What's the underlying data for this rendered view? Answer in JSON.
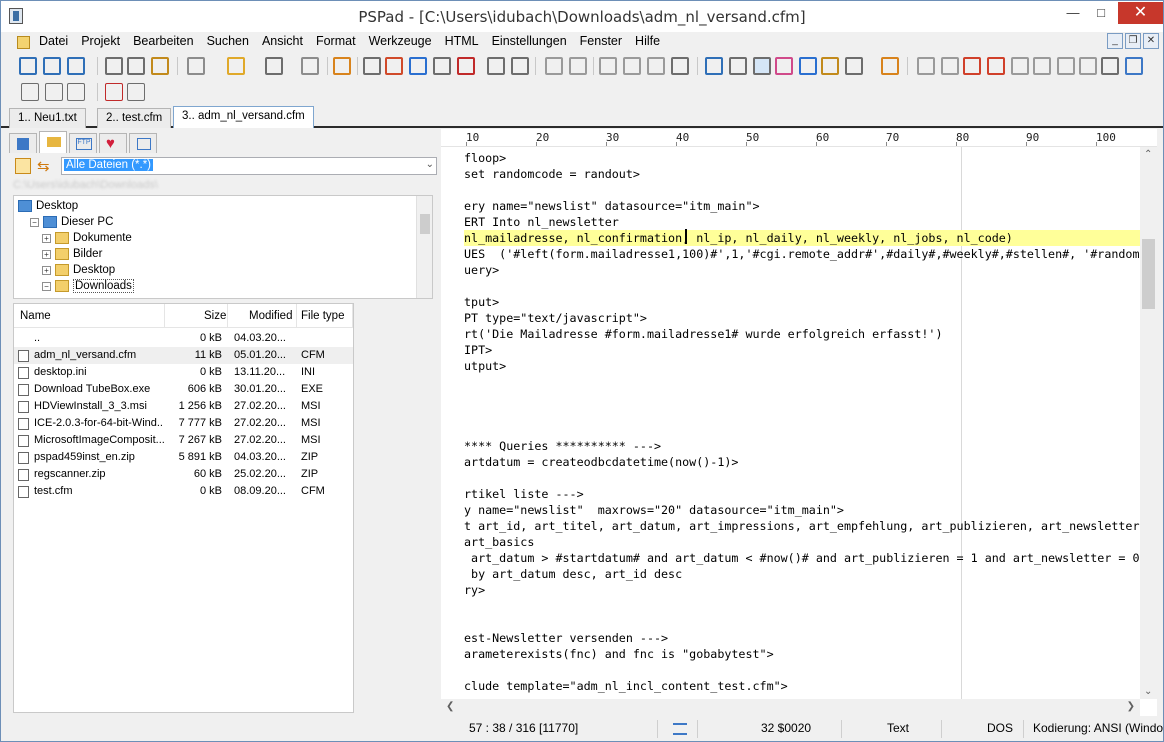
{
  "window": {
    "title": "PSPad - [C:\\Users\\idubach\\Downloads\\adm_nl_versand.cfm]"
  },
  "menu": [
    "Datei",
    "Projekt",
    "Bearbeiten",
    "Suchen",
    "Ansicht",
    "Format",
    "Werkzeuge",
    "HTML",
    "Einstellungen",
    "Fenster",
    "Hilfe"
  ],
  "tabs": [
    "1.. Neu1.txt",
    "2.. test.cfm",
    "3.. adm_nl_versand.cfm"
  ],
  "filter": {
    "value": "Alle Dateien (*.*)"
  },
  "tree": [
    {
      "label": "Desktop",
      "indent": 0,
      "icon": "desktop-icon"
    },
    {
      "label": "Dieser PC",
      "indent": 1,
      "icon": "pc-icon"
    },
    {
      "label": "Dokumente",
      "indent": 2,
      "icon": "folder-icon"
    },
    {
      "label": "Bilder",
      "indent": 2,
      "icon": "folder-icon"
    },
    {
      "label": "Desktop",
      "indent": 2,
      "icon": "folder-icon"
    },
    {
      "label": "Downloads",
      "indent": 2,
      "icon": "folder-icon"
    }
  ],
  "filelist": {
    "headers": {
      "name": "Name",
      "size": "Size",
      "modified": "Modified",
      "type": "File type"
    },
    "rows": [
      {
        "name": "..",
        "size": "0 kB",
        "modified": "04.03.20...",
        "type": ""
      },
      {
        "name": "adm_nl_versand.cfm",
        "size": "11 kB",
        "modified": "05.01.20...",
        "type": "CFM"
      },
      {
        "name": "desktop.ini",
        "size": "0 kB",
        "modified": "13.11.20...",
        "type": "INI"
      },
      {
        "name": "Download TubeBox.exe",
        "size": "606 kB",
        "modified": "30.01.20...",
        "type": "EXE"
      },
      {
        "name": "HDViewInstall_3_3.msi",
        "size": "1 256 kB",
        "modified": "27.02.20...",
        "type": "MSI"
      },
      {
        "name": "ICE-2.0.3-for-64-bit-Wind...",
        "size": "7 777 kB",
        "modified": "27.02.20...",
        "type": "MSI"
      },
      {
        "name": "MicrosoftImageComposit...",
        "size": "7 267 kB",
        "modified": "27.02.20...",
        "type": "MSI"
      },
      {
        "name": "pspad459inst_en.zip",
        "size": "5 891 kB",
        "modified": "04.03.20...",
        "type": "ZIP"
      },
      {
        "name": "regscanner.zip",
        "size": "60 kB",
        "modified": "25.02.20...",
        "type": "ZIP"
      },
      {
        "name": "test.cfm",
        "size": "0 kB",
        "modified": "08.09.20...",
        "type": "CFM"
      }
    ]
  },
  "ruler": [
    "10",
    "20",
    "30",
    "40",
    "50",
    "60",
    "70",
    "80",
    "90",
    "100"
  ],
  "code_lines": [
    "floop>",
    "set randomcode = randout>",
    "",
    "ery name=\"newslist\" datasource=\"itm_main\">",
    "ERT Into nl_newsletter",
    "nl_mailadresse, nl_confirmation, nl_ip, nl_daily, nl_weekly, nl_jobs, nl_code)",
    "UES  ('#left(form.mailadresse1,100)#',1,'#cgi.remote_addr#',#daily#,#weekly#,#stellen#, '#randomcode#')",
    "uery>",
    "",
    "tput>",
    "PT type=\"text/javascript\">",
    "rt('Die Mailadresse #form.mailadresse1# wurde erfolgreich erfasst!')",
    "IPT>",
    "utput>",
    "",
    "",
    "",
    "",
    "**** Queries ********** --->",
    "artdatum = createodbcdatetime(now()-1)>",
    "",
    "rtikel liste --->",
    "y name=\"newslist\"  maxrows=\"20\" datasource=\"itm_main\">",
    "t art_id, art_titel, art_datum, art_impressions, art_empfehlung, art_publizieren, art_newsletter",
    "art_basics",
    " art_datum > #startdatum# and art_datum < #now()# and art_publizieren = 1 and art_newsletter = 0",
    " by art_datum desc, art_id desc",
    "ry>",
    "",
    "",
    "est-Newsletter versenden --->",
    "arameterexists(fnc) and fnc is \"gobabytest\">",
    "",
    "clude template=\"adm_nl_incl_content_test.cfm\">"
  ],
  "highlight_line": 6,
  "status": {
    "position": "57 : 38 / 316  [11770]",
    "char": "32  $0020",
    "mode": "Text",
    "lineend": "DOS",
    "encoding": "Kodierung: ANSI (Windo"
  }
}
